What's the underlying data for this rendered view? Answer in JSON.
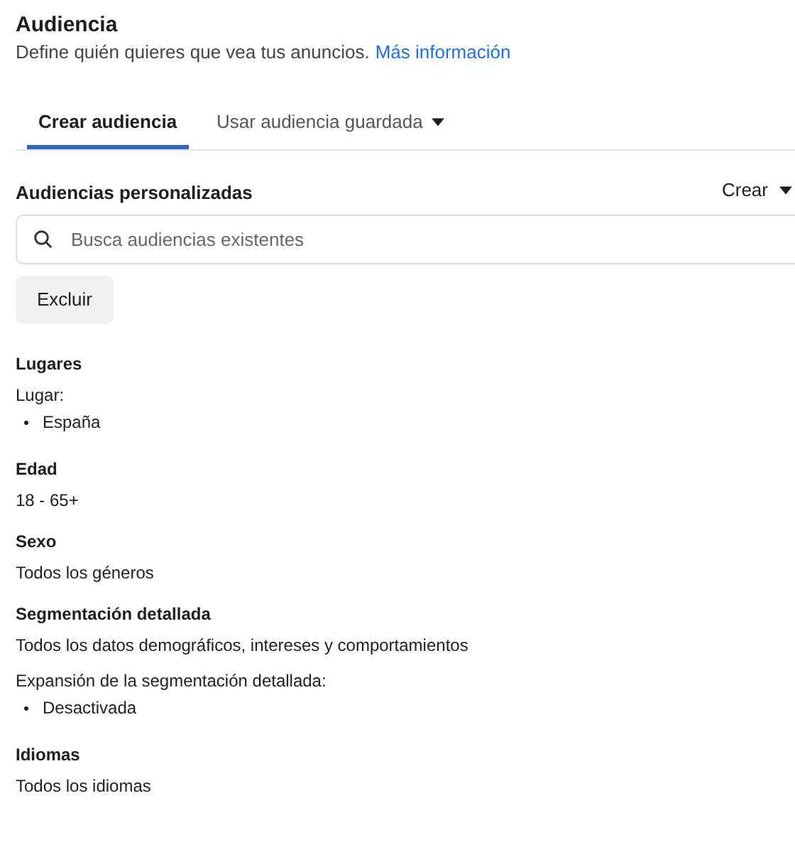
{
  "header": {
    "title": "Audiencia",
    "description": "Define quién quieres que vea tus anuncios.",
    "link": "Más información"
  },
  "tabs": [
    {
      "label": "Crear audiencia",
      "selected": true,
      "dropdown": false
    },
    {
      "label": "Usar audiencia guardada",
      "selected": false,
      "dropdown": true
    }
  ],
  "custom_audiences": {
    "title": "Audiencias personalizadas",
    "create_button": "Crear",
    "search": {
      "placeholder": "Busca audiencias existentes"
    },
    "exclude_button": "Excluir"
  },
  "sections": [
    {
      "title": "Lugares",
      "lines": [
        {
          "kind": "text",
          "text": "Lugar:"
        },
        {
          "kind": "bullet",
          "text": "España"
        }
      ]
    },
    {
      "title": "Edad",
      "lines": [
        {
          "kind": "text",
          "text": "18 - 65+"
        }
      ]
    },
    {
      "title": "Sexo",
      "lines": [
        {
          "kind": "text",
          "text": "Todos los géneros"
        }
      ]
    },
    {
      "title": "Segmentación detallada",
      "lines": [
        {
          "kind": "text",
          "text": "Todos los datos demográficos, intereses y comportamientos"
        },
        {
          "kind": "text",
          "text": "Expansión de la segmentación detallada:"
        },
        {
          "kind": "bullet",
          "text": "Desactivada"
        }
      ]
    },
    {
      "title": "Idiomas",
      "lines": [
        {
          "kind": "text",
          "text": "Todos los idiomas"
        }
      ]
    }
  ]
}
